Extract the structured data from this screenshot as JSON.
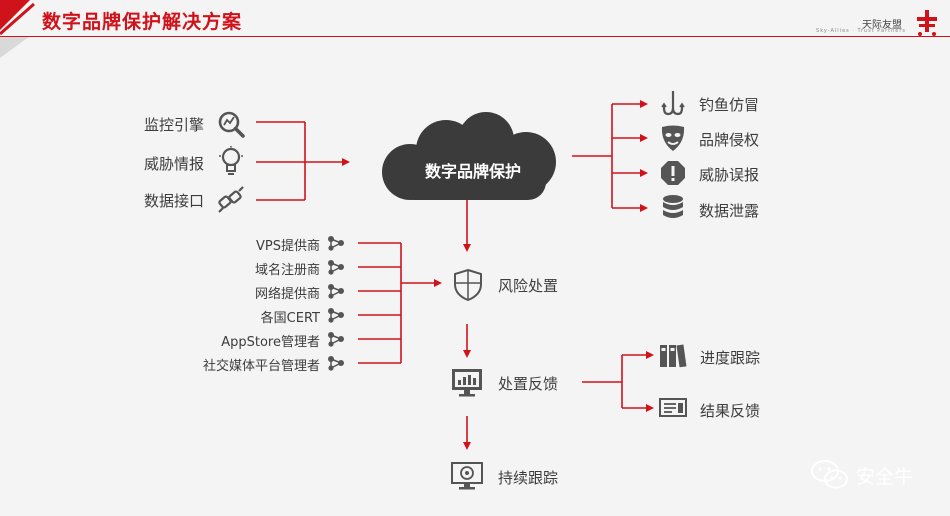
{
  "header": {
    "title": "数字品牌保护解决方案",
    "brand_name": "天际友盟",
    "brand_sub": "Sky-Allies · Trust Partners"
  },
  "sources": [
    {
      "label": "监控引擎",
      "icon": "magnifier-chart-icon"
    },
    {
      "label": "威胁情报",
      "icon": "lightbulb-icon"
    },
    {
      "label": "数据接口",
      "icon": "plug-icon"
    }
  ],
  "center": {
    "label": "数字品牌保护",
    "icon": "cloud-icon"
  },
  "threats": [
    {
      "label": "钓鱼仿冒",
      "icon": "fishhook-icon"
    },
    {
      "label": "品牌侵权",
      "icon": "mask-icon"
    },
    {
      "label": "威胁误报",
      "icon": "exclamation-icon"
    },
    {
      "label": "数据泄露",
      "icon": "database-icon"
    }
  ],
  "providers": [
    {
      "label": "VPS提供商",
      "icon": "share-icon"
    },
    {
      "label": "域名注册商",
      "icon": "share-icon"
    },
    {
      "label": "网络提供商",
      "icon": "share-icon"
    },
    {
      "label": "各国CERT",
      "icon": "share-icon"
    },
    {
      "label": "AppStore管理者",
      "icon": "share-icon"
    },
    {
      "label": "社交媒体平台管理者",
      "icon": "share-icon"
    }
  ],
  "flow": [
    {
      "label": "风险处置",
      "icon": "shield-icon"
    },
    {
      "label": "处置反馈",
      "icon": "monitor-chart-icon"
    },
    {
      "label": "持续跟踪",
      "icon": "monitor-target-icon"
    }
  ],
  "feedback_outputs": [
    {
      "label": "进度跟踪",
      "icon": "binders-icon"
    },
    {
      "label": "结果反馈",
      "icon": "document-list-icon"
    }
  ],
  "watermark": {
    "label": "安全牛",
    "icon": "wechat-icon"
  },
  "colors": {
    "accent": "#d0121b",
    "cloud": "#3b3b3b",
    "icon": "#555555",
    "text": "#3d3d3d"
  }
}
